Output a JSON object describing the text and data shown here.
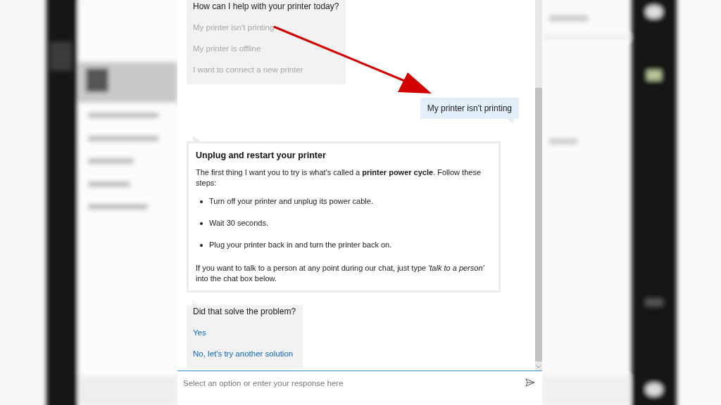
{
  "conversation": [
    {
      "kind": "choice",
      "prompt": "How can I help with your printer today?",
      "options": [
        {
          "label": "My printer isn't printing",
          "disabled": true
        },
        {
          "label": "My printer is offline",
          "disabled": true
        },
        {
          "label": "I want to connect a new printer",
          "disabled": true
        }
      ]
    },
    {
      "kind": "user",
      "text": "My printer isn't printing"
    },
    {
      "kind": "card",
      "title": "Unplug and restart your printer",
      "intro": "The first thing I want you to try is what's called a **printer power cycle**. Follow these steps:",
      "steps": [
        "Turn off your printer and unplug its power cable.",
        "Wait 30 seconds.",
        "Plug your printer back in and turn the printer back on."
      ],
      "footer": "If you want to talk to a person at any point during our chat, just type *'talk to a person'* into the chat box below."
    },
    {
      "kind": "choice",
      "prompt": "Did that solve the problem?",
      "options": [
        {
          "label": "Yes",
          "disabled": false
        },
        {
          "label": "No, let's try another solution",
          "disabled": false
        }
      ]
    }
  ],
  "input": {
    "placeholder": "Select an option or enter your response here"
  }
}
